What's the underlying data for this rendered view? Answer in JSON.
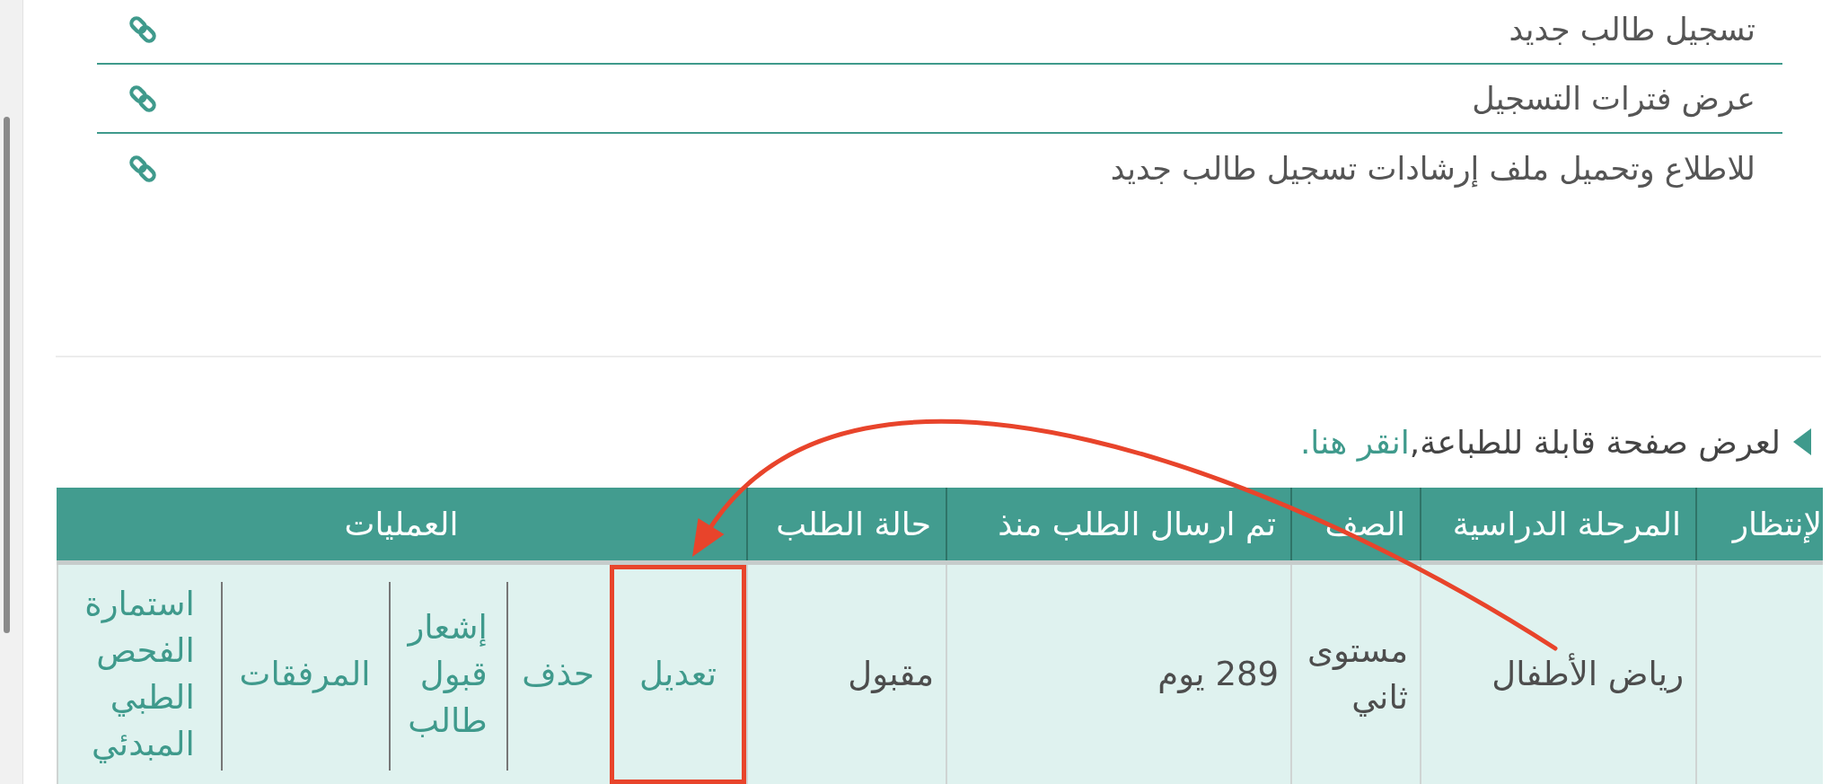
{
  "links": [
    {
      "label": "تسجيل طالب جديد"
    },
    {
      "label": "عرض فترات التسجيل"
    },
    {
      "label": "للاطلاع وتحميل ملف إرشادات تسجيل طالب جديد"
    }
  ],
  "print_notice": {
    "text": "لعرض صفحة قابلة للطباعة,",
    "link": "انقر هنا."
  },
  "table": {
    "columns": [
      "لإنتظار",
      "المرحلة الدراسية",
      "الصف",
      "تم ارسال الطلب منذ",
      "حالة الطلب",
      "العمليات"
    ],
    "rows": [
      {
        "stage": "رياض الأطفال",
        "grade": "مستوى ثاني",
        "elapsed": "289 يوم",
        "status": "مقبول",
        "operations": [
          {
            "label": "تعديل",
            "highlighted": true
          },
          {
            "label": "حذف",
            "highlighted": false
          },
          {
            "label": "إشعار قبول طالب",
            "highlighted": false
          },
          {
            "label": "المرفقات",
            "highlighted": false
          },
          {
            "label": "استمارة الفحص الطبي المبدئي",
            "highlighted": false
          }
        ]
      }
    ]
  }
}
